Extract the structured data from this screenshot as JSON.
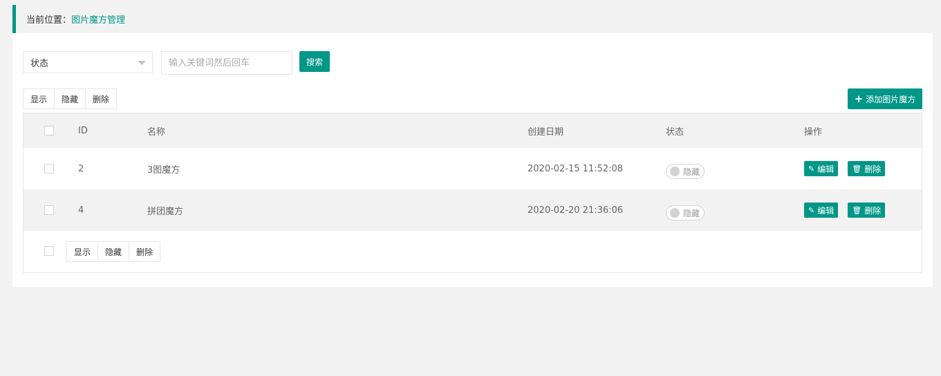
{
  "breadcrumb": {
    "prefix": "当前位置：",
    "current": "图片魔方管理"
  },
  "filters": {
    "status_select": "状态",
    "search_placeholder": "输入关键词然后回车",
    "search_button": "搜索"
  },
  "toolbar": {
    "show": "显示",
    "hide": "隐藏",
    "delete": "删除",
    "add": "添加图片魔方"
  },
  "table": {
    "headers": {
      "id": "ID",
      "name": "名称",
      "date": "创建日期",
      "status": "状态",
      "ops": "操作"
    },
    "rows": [
      {
        "id": "2",
        "name": "3图魔方",
        "date": "2020-02-15 11:52:08",
        "status": "隐藏"
      },
      {
        "id": "4",
        "name": "拼团魔方",
        "date": "2020-02-20 21:36:06",
        "status": "隐藏"
      }
    ],
    "edit_label": "编辑",
    "delete_label": "删除"
  },
  "footer": {
    "show": "显示",
    "hide": "隐藏",
    "delete": "删除"
  },
  "colors": {
    "accent": "#009688",
    "background": "#f2f2f2"
  },
  "icons": {
    "add": "plus-icon",
    "edit": "pencil-icon",
    "delete": "trash-icon",
    "select": "caret-down-icon"
  }
}
